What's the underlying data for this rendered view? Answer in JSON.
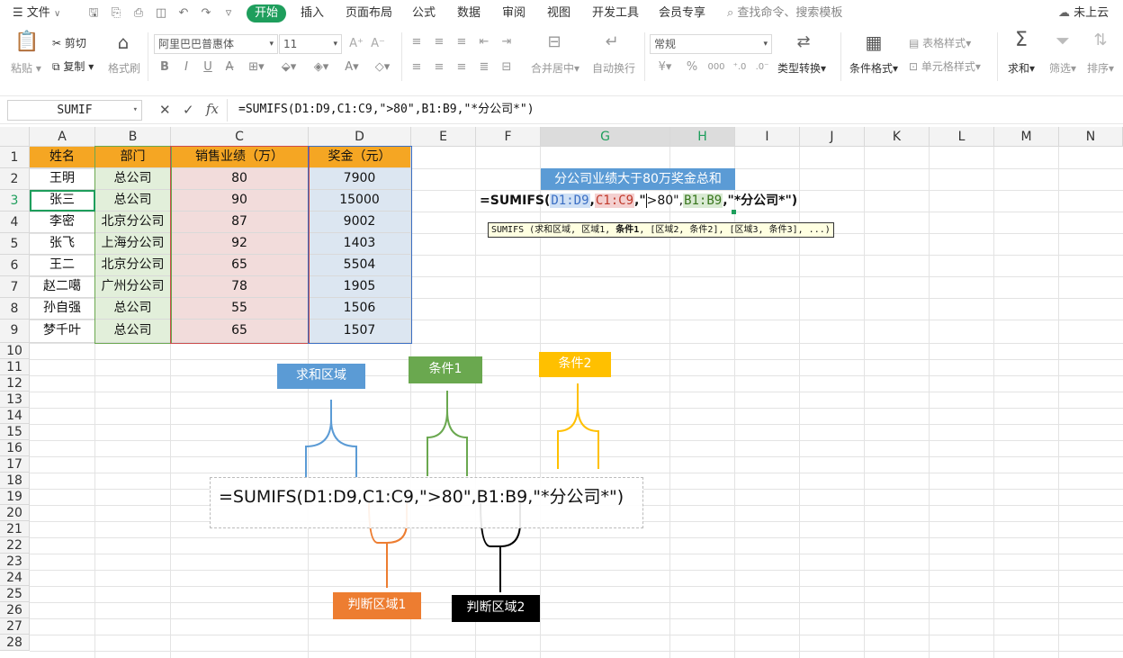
{
  "menubar": {
    "file_label": "文件",
    "tabs": [
      "开始",
      "插入",
      "页面布局",
      "公式",
      "数据",
      "审阅",
      "视图",
      "开发工具",
      "会员专享"
    ],
    "active_tab": "开始",
    "search_placeholder": "查找命令、搜索模板",
    "cloud_label": "未上云"
  },
  "ribbon": {
    "paste": "粘贴",
    "cut": "剪切",
    "copy": "复制",
    "format_painter": "格式刷",
    "font_name": "阿里巴巴普惠体",
    "font_size": "11",
    "merge_center": "合并居中",
    "wrap": "自动换行",
    "number_format": "常规",
    "type_convert": "类型转换",
    "cond_format": "条件格式",
    "table_style": "表格样式",
    "cell_style": "单元格样式",
    "sum": "求和",
    "filter": "筛选",
    "sort": "排序"
  },
  "formula_bar": {
    "name_box": "SUMIF",
    "fx": "fx",
    "formula": "=SUMIFS(D1:D9,C1:C9,\">80\",B1:B9,\"*分公司*\")"
  },
  "columns": [
    "A",
    "B",
    "C",
    "D",
    "E",
    "F",
    "G",
    "H",
    "I",
    "J",
    "K",
    "L",
    "M",
    "N"
  ],
  "rows": [
    "1",
    "2",
    "3",
    "4",
    "5",
    "6",
    "7",
    "8",
    "9",
    "10",
    "11",
    "12",
    "13",
    "14",
    "15",
    "16",
    "17",
    "18",
    "19",
    "20",
    "21",
    "22",
    "23",
    "24",
    "25",
    "26",
    "27",
    "28"
  ],
  "table": {
    "headers": [
      "姓名",
      "部门",
      "销售业绩（万）",
      "奖金（元）"
    ],
    "rows": [
      [
        "王明",
        "总公司",
        "80",
        "7900"
      ],
      [
        "张三",
        "总公司",
        "90",
        "15000"
      ],
      [
        "李密",
        "北京分公司",
        "87",
        "9002"
      ],
      [
        "张飞",
        "上海分公司",
        "92",
        "1403"
      ],
      [
        "王二",
        "北京分公司",
        "65",
        "5504"
      ],
      [
        "赵二噶",
        "广州分公司",
        "78",
        "1905"
      ],
      [
        "孙自强",
        "总公司",
        "55",
        "1506"
      ],
      [
        "梦千叶",
        "总公司",
        "65",
        "1507"
      ]
    ]
  },
  "g2_header": "分公司业绩大于80万奖金总和",
  "edit_formula": {
    "prefix": "=SUMIFS(",
    "arg1": "D1:D9",
    "arg2": "C1:C9",
    "arg3_a": "\"",
    "arg3_b": ">80\",",
    "arg4": "B1:B9",
    "suffix": ",\"*分公司*\")"
  },
  "tooltip": {
    "pre": "SUMIFS (求和区域, 区域1, ",
    "bold": "条件1",
    "post": ", [区域2, 条件2], [区域3, 条件3], ...)"
  },
  "big_formula": "=SUMIFS(D1:D9,C1:C9,\">80\",B1:B9,\"*分公司*\")",
  "annotations": {
    "sum_range": "求和区域",
    "cond1": "条件1",
    "cond2": "条件2",
    "range1": "判断区域1",
    "range2": "判断区域2"
  },
  "colors": {
    "header_orange": "#f5a623",
    "dept_green": "#e2efda",
    "sales_pink": "#f2dcdb",
    "bonus_blue": "#dce6f1",
    "accent_green": "#1e9e5c"
  }
}
